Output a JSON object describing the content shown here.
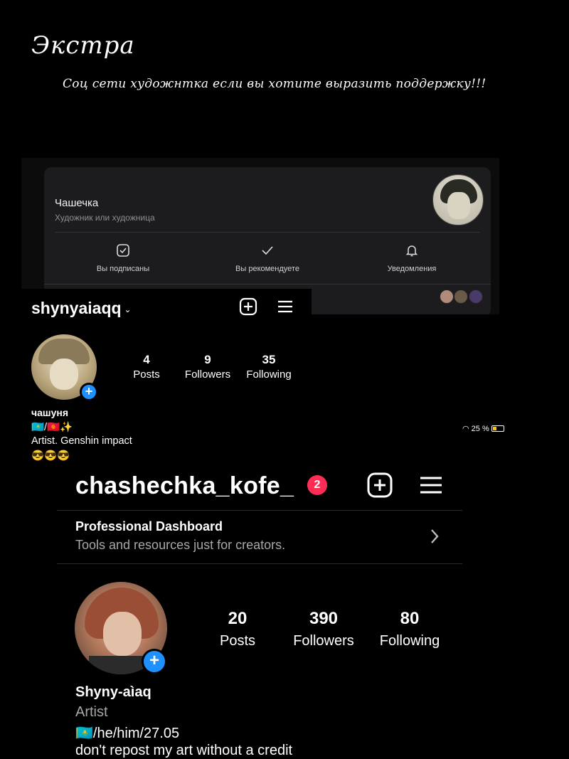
{
  "header": {
    "title": "Экстра",
    "subtitle": "Соц сети художнтка если вы хотите выразить поддержку!!!"
  },
  "card": {
    "name": "Чашечка",
    "role": "Художник или художница",
    "actions": [
      {
        "label": "Вы подписаны",
        "icon": "check-box-icon"
      },
      {
        "label": "Вы рекомендуете",
        "icon": "checkmark-icon"
      },
      {
        "label": "Уведомления",
        "icon": "bell-icon"
      }
    ]
  },
  "profile1": {
    "username": "shynyaiaqq",
    "stats": [
      {
        "value": "4",
        "label": "Posts"
      },
      {
        "value": "9",
        "label": "Followers"
      },
      {
        "value": "35",
        "label": "Following"
      }
    ],
    "name": "чашуня",
    "bio_lines": [
      "🇰🇿/🇰🇬✨",
      "Artist. Genshin impact",
      "😎😎😎"
    ]
  },
  "status_bar": {
    "battery": "25 %"
  },
  "profile2": {
    "username": "chashechka_kofe_",
    "notification_count": "2",
    "dashboard_title": "Professional Dashboard",
    "dashboard_subtitle": "Tools and resources just for creators.",
    "stats": [
      {
        "value": "20",
        "label": "Posts"
      },
      {
        "value": "390",
        "label": "Followers"
      },
      {
        "value": "80",
        "label": "Following"
      }
    ],
    "name": "Shyny-aìaq",
    "category": "Artist",
    "bio_lines": [
      "🇰🇿/he/him/27.05",
      "don't repost my art without a credit"
    ]
  },
  "colors": {
    "accent_blue": "#1e90ff",
    "badge_red": "#ff2d55",
    "card_bg": "#1c1c1e"
  }
}
